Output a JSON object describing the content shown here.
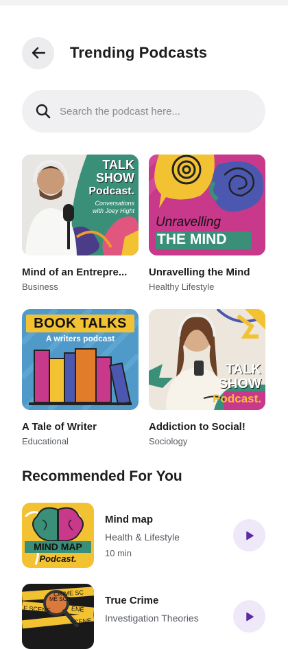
{
  "header": {
    "title": "Trending Podcasts",
    "back_icon": "arrow-left-icon"
  },
  "search": {
    "placeholder": "Search the podcast here...",
    "value": "",
    "icon": "search-icon"
  },
  "trending": [
    {
      "title": "Mind of an Entrepre...",
      "category": "Business",
      "cover_line1": "TALK",
      "cover_line2": "SHOW",
      "cover_line3": "Podcast.",
      "cover_line4": "Conversations",
      "cover_line5": "with Joey Hight"
    },
    {
      "title": "Unravelling the Mind",
      "category": "Healthy Lifestyle",
      "cover_line1": "Unravelling",
      "cover_line2": "THE MIND"
    },
    {
      "title": "A Tale of Writer",
      "category": "Educational",
      "cover_line1": "BOOK TALKS",
      "cover_line2": "A writers podcast"
    },
    {
      "title": "Addiction to Social!",
      "category": "Sociology",
      "cover_line1": "TALK",
      "cover_line2": "SHOW",
      "cover_line3": "Podcast."
    }
  ],
  "recommended": {
    "title": "Recommended For You",
    "items": [
      {
        "title": "Mind map",
        "category": "Health & Lifestyle",
        "duration": "10 min",
        "cover_line1": "MIND MAP",
        "cover_line2": "Podcast."
      },
      {
        "title": "True Crime",
        "category": "Investigation Theories",
        "duration": "",
        "cover_line1": "CRIME SC",
        "cover_line2": "E SCENE",
        "cover_line3": "ME SCE",
        "cover_line4": "ENE",
        "cover_line5": "SCENE"
      }
    ]
  },
  "colors": {
    "accent": "#5b2aa6",
    "play_bg": "#efe8f8",
    "search_bg": "#f0f0f2"
  }
}
